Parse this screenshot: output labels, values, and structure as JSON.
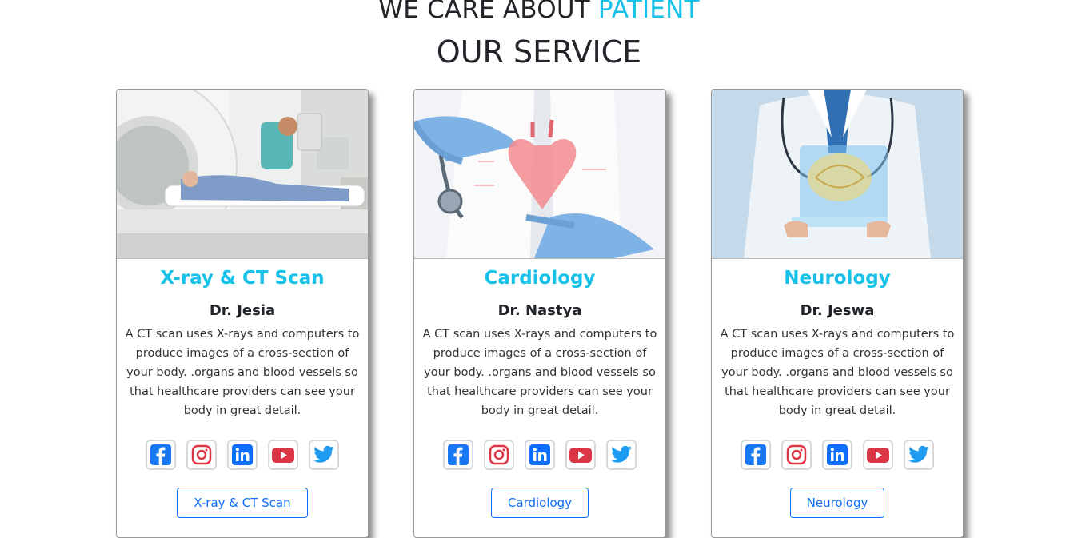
{
  "header": {
    "tagline_prefix": "WE CARE ABOUT",
    "tagline_accent": "PATIENT",
    "title": "OUR SERVICE"
  },
  "services": [
    {
      "title": "X-ray & CT Scan",
      "doctor": "Dr. Jesia",
      "description": "A CT scan uses X-rays and computers to produce images of a cross-section of your body. .organs and blood vessels so that healthcare providers can see your body in great detail.",
      "button_label": "X-ray & CT Scan",
      "image": "ct-scan-photo"
    },
    {
      "title": "Cardiology",
      "doctor": "Dr. Nastya",
      "description": "A CT scan uses X-rays and computers to produce images of a cross-section of your body. .organs and blood vessels so that healthcare providers can see your body in great detail.",
      "button_label": "Cardiology",
      "image": "heart-hologram-photo"
    },
    {
      "title": "Neurology",
      "doctor": "Dr. Jeswa",
      "description": "A CT scan uses X-rays and computers to produce images of a cross-section of your body. .organs and blood vessels so that healthcare providers can see your body in great detail.",
      "button_label": "Neurology",
      "image": "brain-hologram-photo"
    }
  ],
  "social_icons": [
    "facebook-icon",
    "instagram-icon",
    "linkedin-icon",
    "youtube-icon",
    "twitter-icon"
  ],
  "colors": {
    "accent": "#17c1e8",
    "button": "#0d6efd",
    "facebook": "#1877f2",
    "instagram": "#dc3545",
    "linkedin": "#0d6efd",
    "youtube": "#dc3545",
    "twitter": "#1d9bf0"
  }
}
